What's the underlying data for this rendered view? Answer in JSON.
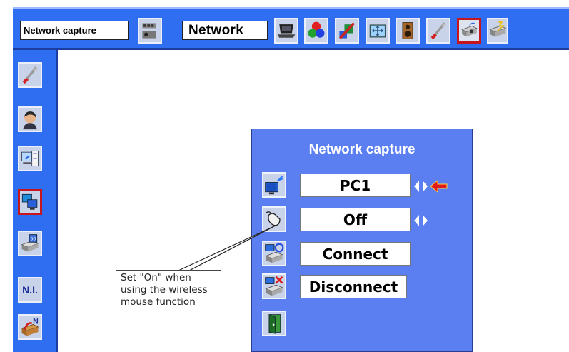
{
  "toolbar": {
    "submenu_label": "Network capture",
    "menu_label": "Network",
    "icons": [
      "network-capture-icon",
      "network-icon",
      "pc-adjust-icon",
      "color-adjust-icon",
      "image-adjust-icon",
      "screen-icon",
      "sound-icon",
      "setting-icon",
      "information-icon",
      "eco-icon"
    ]
  },
  "sidebar": {
    "ni_label": "N.I.",
    "items": [
      "network-setting-icon",
      "network-login-icon",
      "network-information-icon",
      "network-capture-icon",
      "network-viewer-icon",
      "network-initialize-icon",
      "network-update-icon"
    ]
  },
  "dialog": {
    "title": "Network capture",
    "source_value": "PC1",
    "mouse_value": "Off",
    "connect_label": "Connect",
    "disconnect_label": "Disconnect"
  },
  "callout": {
    "text": "Set \"On\" when using the wireless mouse function"
  },
  "colors": {
    "menu_blue": "#2f6ef0",
    "dialog_blue": "#5b7ff0",
    "selection_red": "#c4161c",
    "pointer_red": "#e11b1b"
  }
}
